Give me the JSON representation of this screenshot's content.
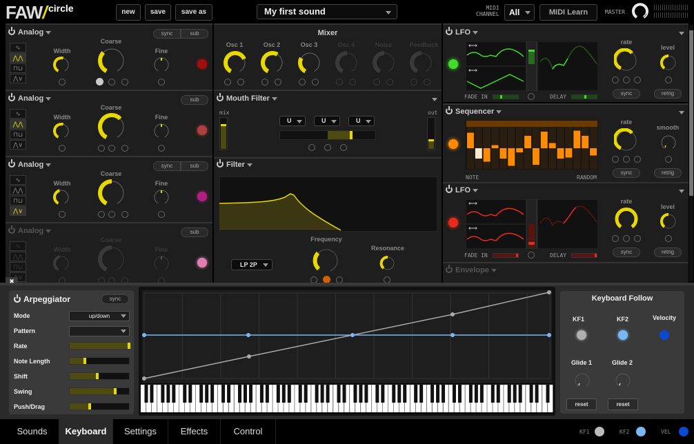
{
  "header": {
    "logo": "FAW",
    "logo_slash": "/",
    "app": "circle",
    "buttons": [
      "new",
      "save",
      "save as"
    ],
    "sound": "My first sound",
    "midi_channel_label": [
      "MIDI",
      "CHANNEL"
    ],
    "midi_channel": "All",
    "midi_learn": "MIDI Learn",
    "master": "MASTER"
  },
  "oscillators": [
    {
      "title": "Analog",
      "buttons": [
        "sync",
        "sub"
      ],
      "width": "Width",
      "coarse": "Coarse",
      "fine": "Fine",
      "wave": 1,
      "led": "#a01010",
      "coarse_val": 0.35,
      "width_val": 0.55
    },
    {
      "title": "Analog",
      "buttons": [
        "sub"
      ],
      "width": "Width",
      "coarse": "Coarse",
      "fine": "Fine",
      "wave": 1,
      "led": "#b04040",
      "coarse_val": 0.65,
      "width_val": 0.55
    },
    {
      "title": "Analog",
      "buttons": [
        "sync",
        "sub"
      ],
      "width": "Width",
      "coarse": "Coarse",
      "fine": "Fine",
      "wave": 3,
      "led": "#b02080",
      "coarse_val": 0.5,
      "width_val": 0.45
    },
    {
      "title": "Analog",
      "buttons": [
        "sub"
      ],
      "width": "Width",
      "coarse": "Coarse",
      "fine": "Fine",
      "wave": -1,
      "led": "#e080b0",
      "coarse_val": 0.5,
      "width_val": 0.45
    }
  ],
  "waveforms": [
    "∿",
    "⋀⋀",
    "⊓⊔",
    "⋀∨"
  ],
  "mixer": {
    "title": "Mixer",
    "channels": [
      {
        "name": "Osc 1",
        "val": 0.72,
        "on": true
      },
      {
        "name": "Osc 2",
        "val": 0.6,
        "on": true
      },
      {
        "name": "Osc 3",
        "val": 0.3,
        "on": true
      },
      {
        "name": "Osc 4",
        "val": 0.5,
        "on": false
      },
      {
        "name": "Noise",
        "val": 0.5,
        "on": false
      },
      {
        "name": "Feedback",
        "val": 0.5,
        "on": false
      }
    ]
  },
  "mouth_filter": {
    "title": "Mouth Filter",
    "mix": "mix",
    "out": "out",
    "vowels": [
      "U",
      "U",
      "U"
    ],
    "mix_level": 0.75,
    "out_level": 0.3
  },
  "filter": {
    "title": "Filter",
    "type": "LP 2P",
    "frequency": "Frequency",
    "resonance": "Resonance"
  },
  "lfo1": {
    "title": "LFO",
    "rate": "rate",
    "level": "level",
    "sync": "sync",
    "retrig": "retrig",
    "fade_in": "FADE IN",
    "delay": "DELAY",
    "color": "#3fdc2a"
  },
  "sequencer": {
    "title": "Sequencer",
    "rate": "rate",
    "smooth": "smooth",
    "sync": "sync",
    "retrig": "retrig",
    "note": "NOTE",
    "random": "RANDOM",
    "steps": [
      0.75,
      -0.5,
      -0.65,
      0.15,
      -0.5,
      -0.85,
      -0.2,
      0.6,
      -0.8,
      0.8,
      0.25,
      -0.5,
      -0.45,
      0.85,
      0.6,
      -0.35
    ]
  },
  "lfo2": {
    "title": "LFO",
    "rate": "rate",
    "level": "level",
    "sync": "sync",
    "retrig": "retrig",
    "fade_in": "FADE IN",
    "delay": "DELAY",
    "color": "#e82a1a"
  },
  "envelope": {
    "title": "Envelope"
  },
  "arpeggiator": {
    "title": "Arpeggiator",
    "sync": "sync",
    "rows": [
      {
        "label": "Mode",
        "type": "select",
        "value": "up/down"
      },
      {
        "label": "Pattern",
        "type": "select",
        "value": ""
      },
      {
        "label": "Rate",
        "type": "slider",
        "value": 1.0
      },
      {
        "label": "Note Length",
        "type": "slider",
        "value": 0.25
      },
      {
        "label": "Shift",
        "type": "slider",
        "value": 0.47
      },
      {
        "label": "Swing",
        "type": "slider",
        "value": 0.77
      },
      {
        "label": "Push/Drag",
        "type": "slider",
        "value": 0.34
      }
    ]
  },
  "keyboard_follow": {
    "title": "Keyboard Follow",
    "kf1": "KF1",
    "kf2": "KF2",
    "velocity": "Velocity",
    "glide1": "Glide 1",
    "glide2": "Glide 2",
    "reset": "reset"
  },
  "tabs": [
    "Sounds",
    "Keyboard",
    "Settings",
    "Effects",
    "Control"
  ],
  "active_tab": "Keyboard",
  "status": {
    "kf1": "KF1",
    "kf2": "KF2",
    "vel": "VEL"
  },
  "colors": {
    "accent": "#e8d800",
    "kf1": "#b0b0b0",
    "kf2": "#7ab8f5",
    "vel": "#0a4ad0"
  }
}
